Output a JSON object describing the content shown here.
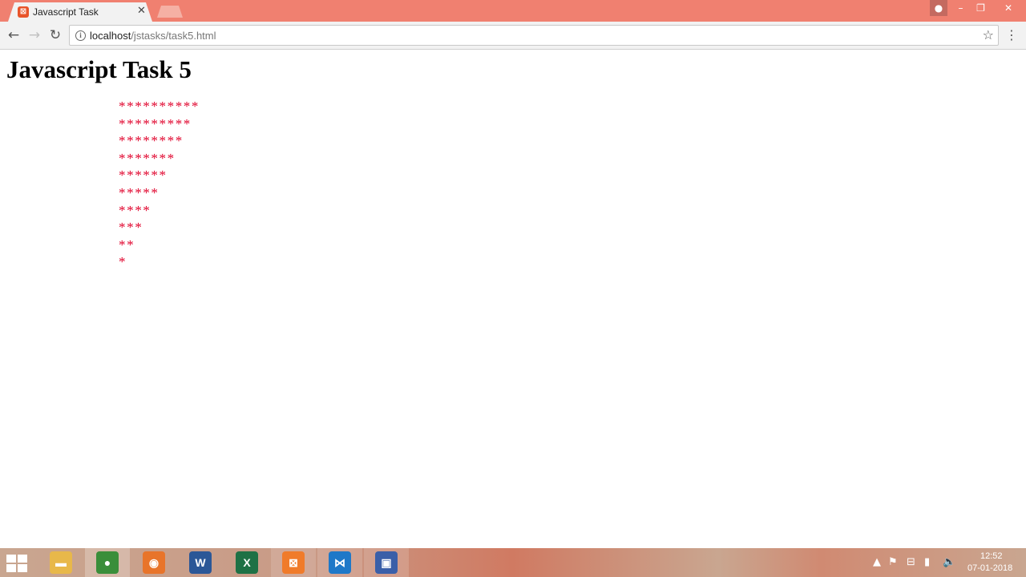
{
  "browser": {
    "tab_title": "Javascript Task",
    "tab_favicon": "xampp-icon",
    "url_host": "localhost",
    "url_path": "/jstasks/task5.html"
  },
  "page": {
    "title": "Javascript Task 5",
    "pattern_rows": [
      "**********",
      "*********",
      "********",
      "*******",
      "******",
      "*****",
      "****",
      "***",
      "**",
      "*"
    ],
    "pattern_color": "#e0002a"
  },
  "taskbar": {
    "apps": [
      {
        "name": "file-explorer-icon",
        "glyph": "▬",
        "color": "#e8b84a"
      },
      {
        "name": "chrome-icon",
        "glyph": "●",
        "color": "#3a8e3a"
      },
      {
        "name": "firefox-icon",
        "glyph": "◉",
        "color": "#e8742a"
      },
      {
        "name": "word-icon",
        "glyph": "W",
        "color": "#2b5797"
      },
      {
        "name": "excel-icon",
        "glyph": "X",
        "color": "#1e7145"
      },
      {
        "name": "xampp-icon",
        "glyph": "⊠",
        "color": "#f07b2a"
      },
      {
        "name": "vscode-icon",
        "glyph": "⋈",
        "color": "#1e78c8"
      },
      {
        "name": "media-icon",
        "glyph": "▣",
        "color": "#3a5fa8"
      }
    ],
    "clock_time": "12:52",
    "clock_date": "07-01-2018"
  }
}
